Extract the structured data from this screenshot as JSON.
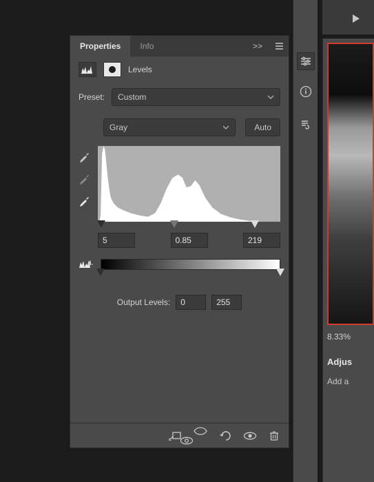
{
  "tabs": {
    "properties": "Properties",
    "info": "Info",
    "expand": ">>"
  },
  "adjustment_name": "Levels",
  "preset": {
    "label": "Preset:",
    "value": "Custom"
  },
  "channel": {
    "value": "Gray"
  },
  "auto_label": "Auto",
  "input_levels": {
    "shadow": "5",
    "mid": "0.85",
    "highlight": "219"
  },
  "output": {
    "label": "Output Levels:",
    "low": "0",
    "high": "255"
  },
  "right": {
    "zoom": "8.33%",
    "adjust": "Adjus",
    "add": "Add a"
  },
  "icons": {
    "hist": "hist",
    "mask": "mask",
    "menu": "menu",
    "eye_black": "bp",
    "eye_gray": "gp",
    "eye_white": "wp",
    "clip": "clip-warn",
    "play": "play",
    "sliders": "sliders",
    "info": "info",
    "stamp": "stamp",
    "f_clip": "clip",
    "f_reset": "reset",
    "f_undo": "undo",
    "f_vis": "vis",
    "f_trash": "trash"
  }
}
